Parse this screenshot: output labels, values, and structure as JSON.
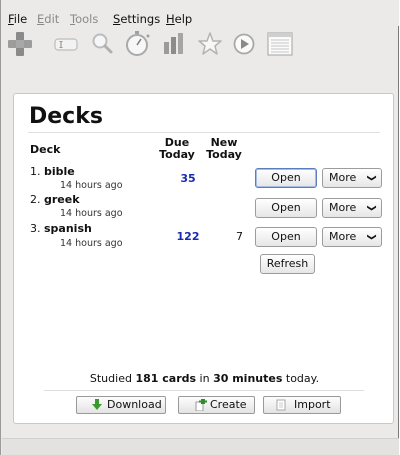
{
  "menu": {
    "items": [
      {
        "acc": "F",
        "rest": "ile",
        "enabled": true
      },
      {
        "acc": "E",
        "rest": "dit",
        "enabled": false
      },
      {
        "acc": "T",
        "rest": "ools",
        "enabled": false
      },
      {
        "acc": "S",
        "rest": "ettings",
        "enabled": true
      },
      {
        "acc": "H",
        "rest": "elp",
        "enabled": true
      }
    ]
  },
  "toolbar": {
    "icons": [
      "add-cards-icon",
      "edit-icon",
      "search-icon",
      "timer-icon",
      "graphs-icon",
      "star-icon",
      "play-icon",
      "list-icon"
    ]
  },
  "decks": {
    "title": "Decks",
    "headers": {
      "deck": "Deck",
      "due": "Due\nToday",
      "new": "New\nToday"
    },
    "rows": [
      {
        "num": "1. ",
        "name": "bible",
        "sub": "14 hours ago",
        "due": "35",
        "new": ""
      },
      {
        "num": "2. ",
        "name": "greek",
        "sub": "14 hours ago",
        "due": "",
        "new": ""
      },
      {
        "num": "3. ",
        "name": "spanish",
        "sub": "14 hours ago",
        "due": "122",
        "new": "7"
      }
    ],
    "open_label": "Open",
    "more_label": "More",
    "refresh_label": "Refresh"
  },
  "stats": {
    "prefix": "Studied ",
    "cards": "181 cards",
    "mid": " in ",
    "time": "30 minutes",
    "suffix": " today."
  },
  "bottom": {
    "download": "Download",
    "create": "Create",
    "import": "Import"
  },
  "colors": {
    "due": "#1a2bb0",
    "focus": "#5a7dbd"
  }
}
